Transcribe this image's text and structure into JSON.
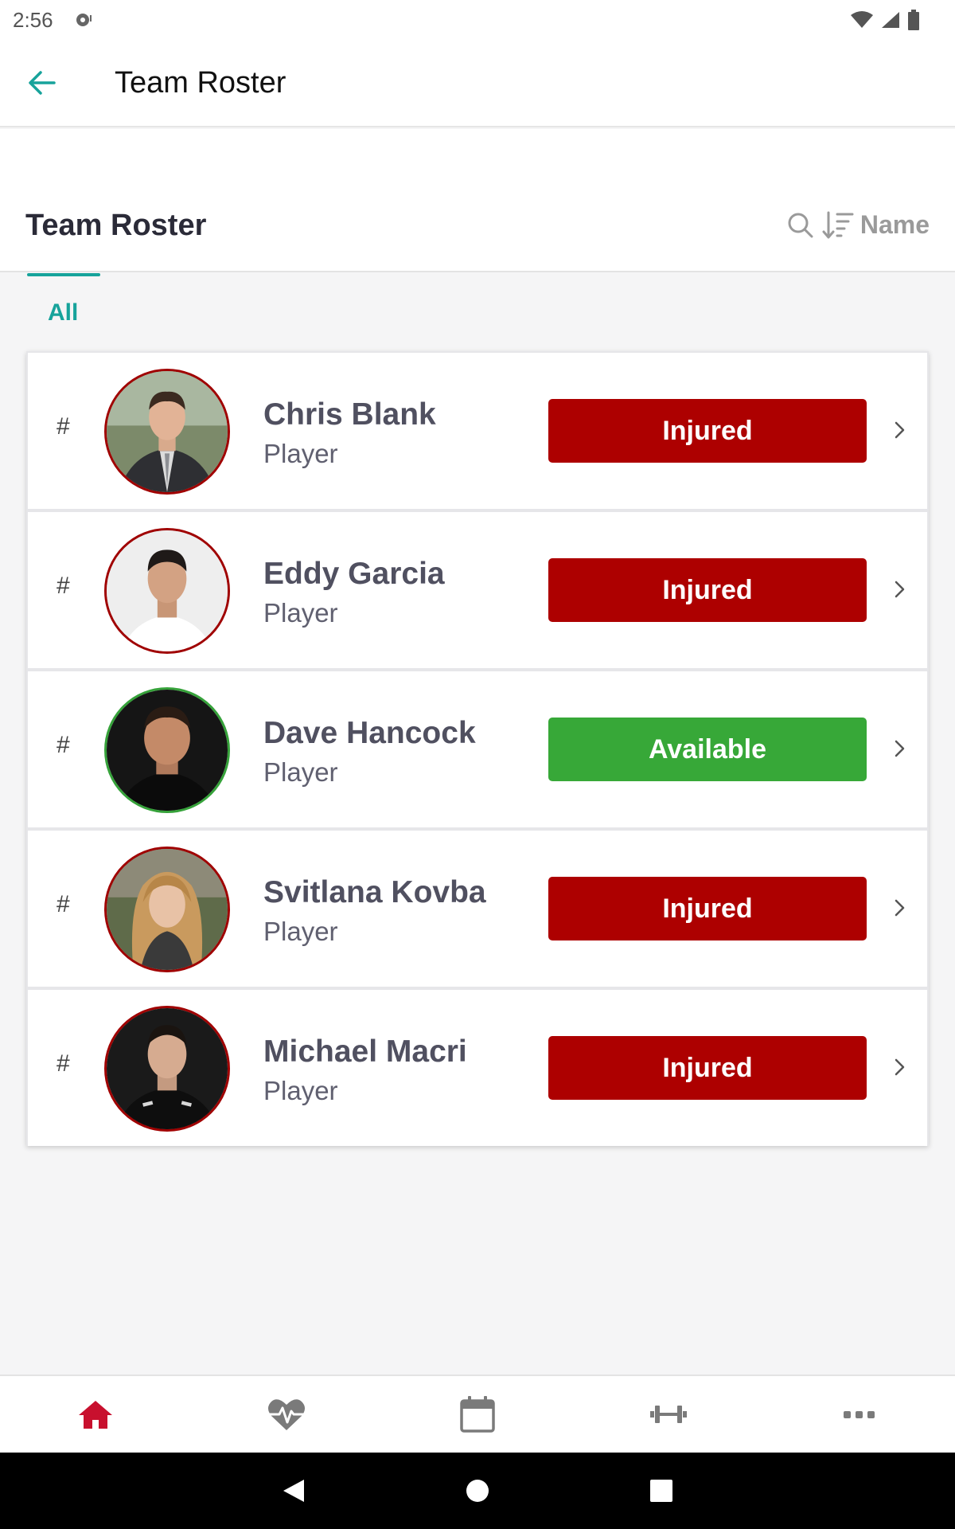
{
  "status_bar": {
    "time": "2:56"
  },
  "app_bar": {
    "title": "Team Roster"
  },
  "header": {
    "title": "Team Roster",
    "sort_label": "Name"
  },
  "tabs": [
    {
      "label": "All",
      "selected": true
    }
  ],
  "roster": [
    {
      "number": "#",
      "name": "Chris Blank",
      "role": "Player",
      "status": "Injured"
    },
    {
      "number": "#",
      "name": "Eddy Garcia",
      "role": "Player",
      "status": "Injured"
    },
    {
      "number": "#",
      "name": "Dave Hancock",
      "role": "Player",
      "status": "Available"
    },
    {
      "number": "#",
      "name": "Svitlana Kovba",
      "role": "Player",
      "status": "Injured"
    },
    {
      "number": "#",
      "name": "Michael Macri",
      "role": "Player",
      "status": "Injured"
    }
  ],
  "bottom_nav": {
    "items": [
      {
        "icon": "home-icon",
        "active": true
      },
      {
        "icon": "heartbeat-icon",
        "active": false
      },
      {
        "icon": "calendar-icon",
        "active": false
      },
      {
        "icon": "dumbbell-icon",
        "active": false
      },
      {
        "icon": "more-icon",
        "active": false
      }
    ]
  },
  "colors": {
    "accent": "#17a39b",
    "injured": "#ad0000",
    "available": "#37a838",
    "nav_active": "#c8102e"
  }
}
